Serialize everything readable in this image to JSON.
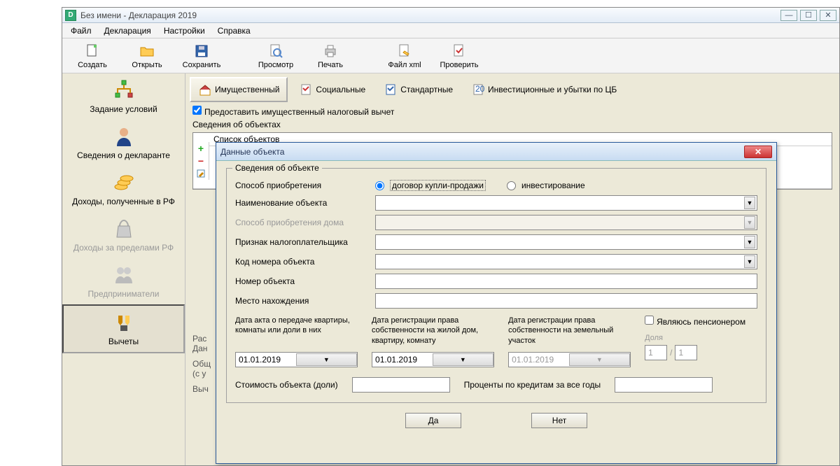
{
  "window": {
    "title": "Без имени - Декларация 2019"
  },
  "menu": {
    "file": "Файл",
    "decl": "Декларация",
    "settings": "Настройки",
    "help": "Справка"
  },
  "toolbar": {
    "create": "Создать",
    "open": "Открыть",
    "save": "Сохранить",
    "preview": "Просмотр",
    "print": "Печать",
    "xml": "Файл xml",
    "check": "Проверить"
  },
  "sidebar": {
    "conditions": "Задание условий",
    "declarant": "Сведения о декларанте",
    "income_rf": "Доходы, полученные в РФ",
    "income_abroad": "Доходы за пределами РФ",
    "entrepreneur": "Предприниматели",
    "deductions": "Вычеты"
  },
  "subtabs": {
    "property": "Имущественный",
    "social": "Социальные",
    "standard": "Стандартные",
    "invest": "Инвестиционные и убытки по ЦБ"
  },
  "check_provide": "Предоставить имущественный налоговый вычет",
  "objects_section": "Сведения об объектах",
  "list_title": "Список объектов",
  "bottom": {
    "calc_label_prefix": "Рас",
    "data_prefix": "Дан",
    "total_prefix": "Общ",
    "with_prefix": "(с у",
    "ded_prefix": "Выч"
  },
  "dialog": {
    "title": "Данные объекта",
    "legend": "Сведения об объекте",
    "acq_method": "Способ приобретения",
    "radio_sale": "договор купли-продажи",
    "radio_invest": "инвестирование",
    "obj_name": "Наименование объекта",
    "house_method": "Способ приобретения дома",
    "taxpayer_sign": "Признак налогоплательщика",
    "obj_code": "Код номера объекта",
    "obj_number": "Номер объекта",
    "location": "Место нахождения",
    "date1_label": "Дата акта о передаче квартиры, комнаты или доли в них",
    "date2_label": "Дата регистрации права собственности на жилой дом, квартиру, комнату",
    "date3_label": "Дата регистрации права собственности на земельный участок",
    "date1": "01.01.2019",
    "date2": "01.01.2019",
    "date3": "01.01.2019",
    "pensioner": "Являюсь пенсионером",
    "share": "Доля",
    "share1": "1",
    "share2": "1",
    "cost": "Стоимость объекта (доли)",
    "interest": "Проценты по кредитам за все годы",
    "yes": "Да",
    "no": "Нет"
  }
}
